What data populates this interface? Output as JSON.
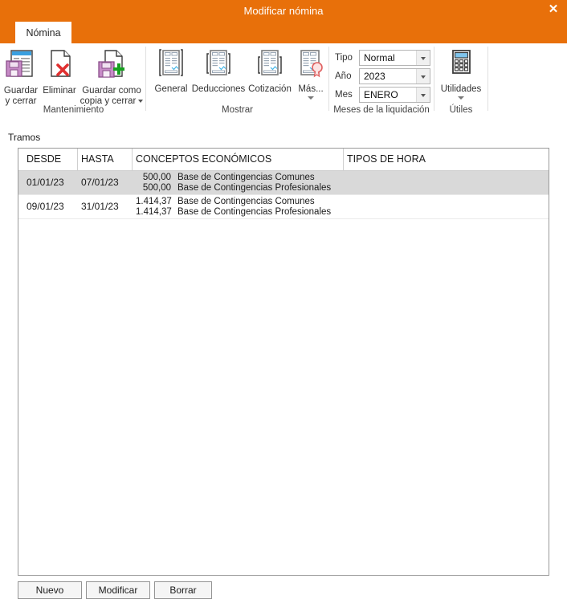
{
  "window": {
    "title": "Modificar nómina",
    "close_label": "✕",
    "accent_color": "#E8700A"
  },
  "tabs": [
    {
      "label": "Nómina",
      "active": true
    }
  ],
  "ribbon": {
    "groups": [
      {
        "name": "Mantenimiento",
        "label": "Mantenimiento",
        "items": [
          {
            "name": "guardar-y-cerrar",
            "label_line1": "Guardar",
            "label_line2": "y cerrar",
            "icon": "save-document-icon",
            "has_caret": false
          },
          {
            "name": "eliminar",
            "label_line1": "Eliminar",
            "label_line2": "",
            "icon": "document-delete-icon",
            "has_caret": false
          },
          {
            "name": "guardar-como-copia-y-cerrar",
            "label_line1": "Guardar como",
            "label_line2": "copia y cerrar",
            "icon": "save-copy-icon",
            "has_caret": true
          }
        ]
      },
      {
        "name": "Mostrar",
        "label": "Mostrar",
        "items": [
          {
            "name": "general",
            "label_line1": "General",
            "label_line2": "",
            "icon": "report-general-icon",
            "has_caret": false
          },
          {
            "name": "deducciones",
            "label_line1": "Deducciones",
            "label_line2": "",
            "icon": "report-deductions-icon",
            "has_caret": false
          },
          {
            "name": "cotizacion",
            "label_line1": "Cotización",
            "label_line2": "",
            "icon": "report-contribution-icon",
            "has_caret": false
          },
          {
            "name": "mas",
            "label_line1": "Más...",
            "label_line2": "",
            "icon": "report-seal-icon",
            "has_caret": true
          }
        ]
      },
      {
        "name": "Meses de la liquidación",
        "label": "Meses de la liquidación",
        "fields": [
          {
            "name": "tipo",
            "label": "Tipo",
            "value": "Normal"
          },
          {
            "name": "ano",
            "label": "Año",
            "value": "2023"
          },
          {
            "name": "mes",
            "label": "Mes",
            "value": "ENERO"
          }
        ]
      },
      {
        "name": "Útiles",
        "label": "Útiles",
        "items": [
          {
            "name": "utilidades",
            "label_line1": "Utilidades",
            "label_line2": "",
            "icon": "calculator-icon",
            "has_caret": true
          }
        ]
      }
    ]
  },
  "main": {
    "section_label": "Tramos",
    "grid": {
      "columns": [
        {
          "key": "desde",
          "label": "DESDE"
        },
        {
          "key": "hasta",
          "label": "HASTA"
        },
        {
          "key": "conceptos",
          "label": "CONCEPTOS ECONÓMICOS"
        },
        {
          "key": "tipos_hora",
          "label": "TIPOS DE HORA"
        }
      ],
      "rows": [
        {
          "selected": true,
          "desde": "01/01/23",
          "hasta": "07/01/23",
          "conceptos": [
            {
              "amount": "500,00",
              "description": "Base de Contingencias Comunes"
            },
            {
              "amount": "500,00",
              "description": "Base de Contingencias Profesionales"
            }
          ],
          "tipos_hora": ""
        },
        {
          "selected": false,
          "desde": "09/01/23",
          "hasta": "31/01/23",
          "conceptos": [
            {
              "amount": "1.414,37",
              "description": "Base de Contingencias Comunes"
            },
            {
              "amount": "1.414,37",
              "description": "Base de Contingencias Profesionales"
            }
          ],
          "tipos_hora": ""
        }
      ]
    },
    "buttons": [
      {
        "name": "nuevo",
        "label": "Nuevo"
      },
      {
        "name": "modificar",
        "label": "Modificar"
      },
      {
        "name": "borrar",
        "label": "Borrar"
      }
    ]
  }
}
